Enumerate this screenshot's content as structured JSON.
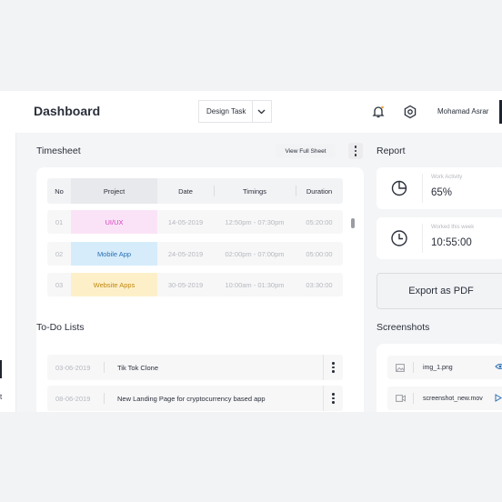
{
  "header": {
    "title": "Dashboard",
    "task_select": "Design Task",
    "user_name": "Mohamad Asrar"
  },
  "sidebar": {
    "partial_label": "t"
  },
  "timesheet": {
    "title": "Timesheet",
    "view_full_label": "View Full Sheet",
    "columns": [
      "No",
      "Project",
      "Date",
      "Timings",
      "Duration"
    ],
    "rows": [
      {
        "no": "01",
        "project": "UI/UX",
        "date": "14-05-2019",
        "timings": "12:50pm - 07:30pm",
        "duration": "05:20:00",
        "chip_bg": "#fbe3f7",
        "chip_fg": "#d23fbf"
      },
      {
        "no": "02",
        "project": "Mobile App",
        "date": "24-05-2019",
        "timings": "02:00pm - 07:00pm",
        "duration": "05:00:00",
        "chip_bg": "#d6ecfb",
        "chip_fg": "#2a6fb3"
      },
      {
        "no": "03",
        "project": "Website Apps",
        "date": "30-05-2019",
        "timings": "10:00am - 01:30pm",
        "duration": "03:30:00",
        "chip_bg": "#fdf0c9",
        "chip_fg": "#c2860f"
      }
    ]
  },
  "report": {
    "title": "Report",
    "work_activity_caption": "Work Activity",
    "work_activity_value": "65%",
    "worked_caption": "Worked this week",
    "worked_value": "10:55:00",
    "export_label": "Export as PDF"
  },
  "todo": {
    "title": "To-Do Lists",
    "items": [
      {
        "date": "03-06-2019",
        "text": "Tik Tok Clone"
      },
      {
        "date": "08-06-2019",
        "text": "New Landing Page for cryptocurrency based app"
      }
    ]
  },
  "screenshots": {
    "title": "Screenshots",
    "items": [
      {
        "name": "img_1.png",
        "type_icon": "image-icon",
        "action_icon": "eye-icon"
      },
      {
        "name": "screenshot_new.mov",
        "type_icon": "video-icon",
        "action_icon": "play-icon"
      }
    ]
  },
  "colors": {
    "accent_dark": "#1f2430",
    "muted_text": "#b6b8be"
  }
}
